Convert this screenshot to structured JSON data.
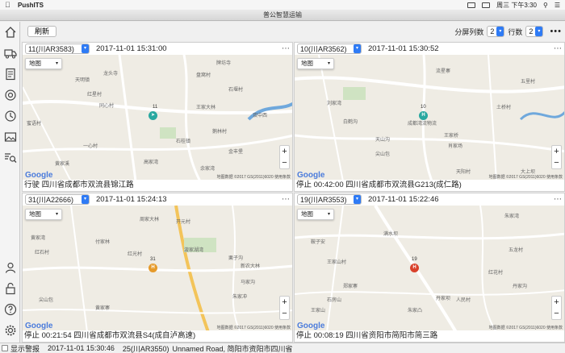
{
  "menubar": {
    "app_name": "PushITS",
    "clock": "周三 下午3:30"
  },
  "window": {
    "title": "普公智慧运输"
  },
  "toolbar": {
    "refresh_label": "刷新",
    "split_label": "分屏列数",
    "split_value": "2",
    "rows_label": "行数",
    "rows_value": "2"
  },
  "map_common": {
    "type_label": "地图",
    "google": "Google",
    "copyright": "地图数据 ©2017 GS(2011)6020   使用条款"
  },
  "panels": [
    {
      "plate": "11(川AR3583)",
      "time": "2017-11-01 15:31:00",
      "status": "行驶  四川省成都市双流县锦江路",
      "marker_num": "11",
      "marker_color": "#29a8a0",
      "labels": [
        "天明镇",
        "龙头寺",
        "红星村",
        "同心村",
        "王家大林",
        "石桂镇",
        "鹅林村",
        "高家湾",
        "一心村",
        "黄家溪",
        "蜜语村",
        "金丰堡",
        "盘窝村",
        "石堰村",
        "余家湾",
        "牌坊寺",
        "双中西"
      ]
    },
    {
      "plate": "10(川AR3562)",
      "time": "2017-11-01 15:30:52",
      "status": "停止 00:42:00  四川省成都市双流县G213(成仁路)",
      "marker_num": "10",
      "marker_color": "#29a8a0",
      "labels": [
        "流星寨",
        "五里村",
        "成都湾流物流",
        "土桥村",
        "白鹤沟",
        "天山沟",
        "刘家湾",
        "肖家场",
        "王家桥",
        "尖山包",
        "天阳村",
        "大上坝"
      ]
    },
    {
      "plate": "31(川A22666)",
      "time": "2017-11-01 15:24:13",
      "status": "停止 00:21:54  四川省成都市双流县S4(成自泸高速)",
      "marker_num": "31",
      "marker_color": "#e59a2a",
      "labels": [
        "周家大林",
        "黄家湾",
        "红石村",
        "开元村",
        "漩家湖湾",
        "栗子沟",
        "红光村",
        "付家林",
        "马家沟",
        "新农大林",
        "朱家冲",
        "尖山包",
        "黄家寨"
      ]
    },
    {
      "plate": "19(川AR3553)",
      "time": "2017-11-01 15:22:46",
      "status": "停止 00:08:19  四川省资阳市简阳市简三路",
      "marker_num": "19",
      "marker_color": "#d9412b",
      "labels": [
        "朱家湾",
        "鞍子安",
        "满水坝",
        "王家山村",
        "五龙村",
        "郑家寨",
        "石房山",
        "王家山",
        "丹家坝",
        "朱家凸",
        "人民村",
        "红花村",
        "丹家沟"
      ]
    }
  ],
  "statusbar": {
    "alarm_label": "显示警报",
    "time": "2017-11-01 15:30:46",
    "plate": "25(川AR3550)",
    "address": "Unnamed Road, 简阳市资阳市四川省"
  }
}
